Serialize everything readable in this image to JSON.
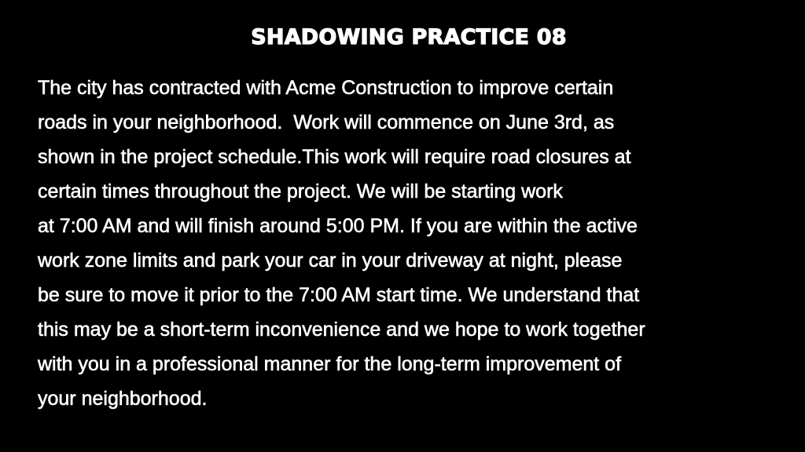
{
  "title": "SHADOWING PRACTICE 08",
  "paragraph_lines": [
    "The city has contracted with Acme Construction to improve certain",
    "roads in your neighborhood.  Work will commence on June 3rd, as",
    "shown in the project schedule.This work will require road closures at",
    "certain times throughout the project. We will be starting work",
    "at 7:00 AM and will finish around 5:00 PM. If you are within the active",
    "work zone limits and park your car in your driveway at night, please",
    "be sure to move it prior to the 7:00 AM start time. We understand that",
    "this may be a short-term inconvenience and we hope to work together",
    "with you in a professional manner for the long-term improvement of",
    "your neighborhood."
  ],
  "colors": {
    "background": "#000000",
    "text": "#ffffff"
  }
}
